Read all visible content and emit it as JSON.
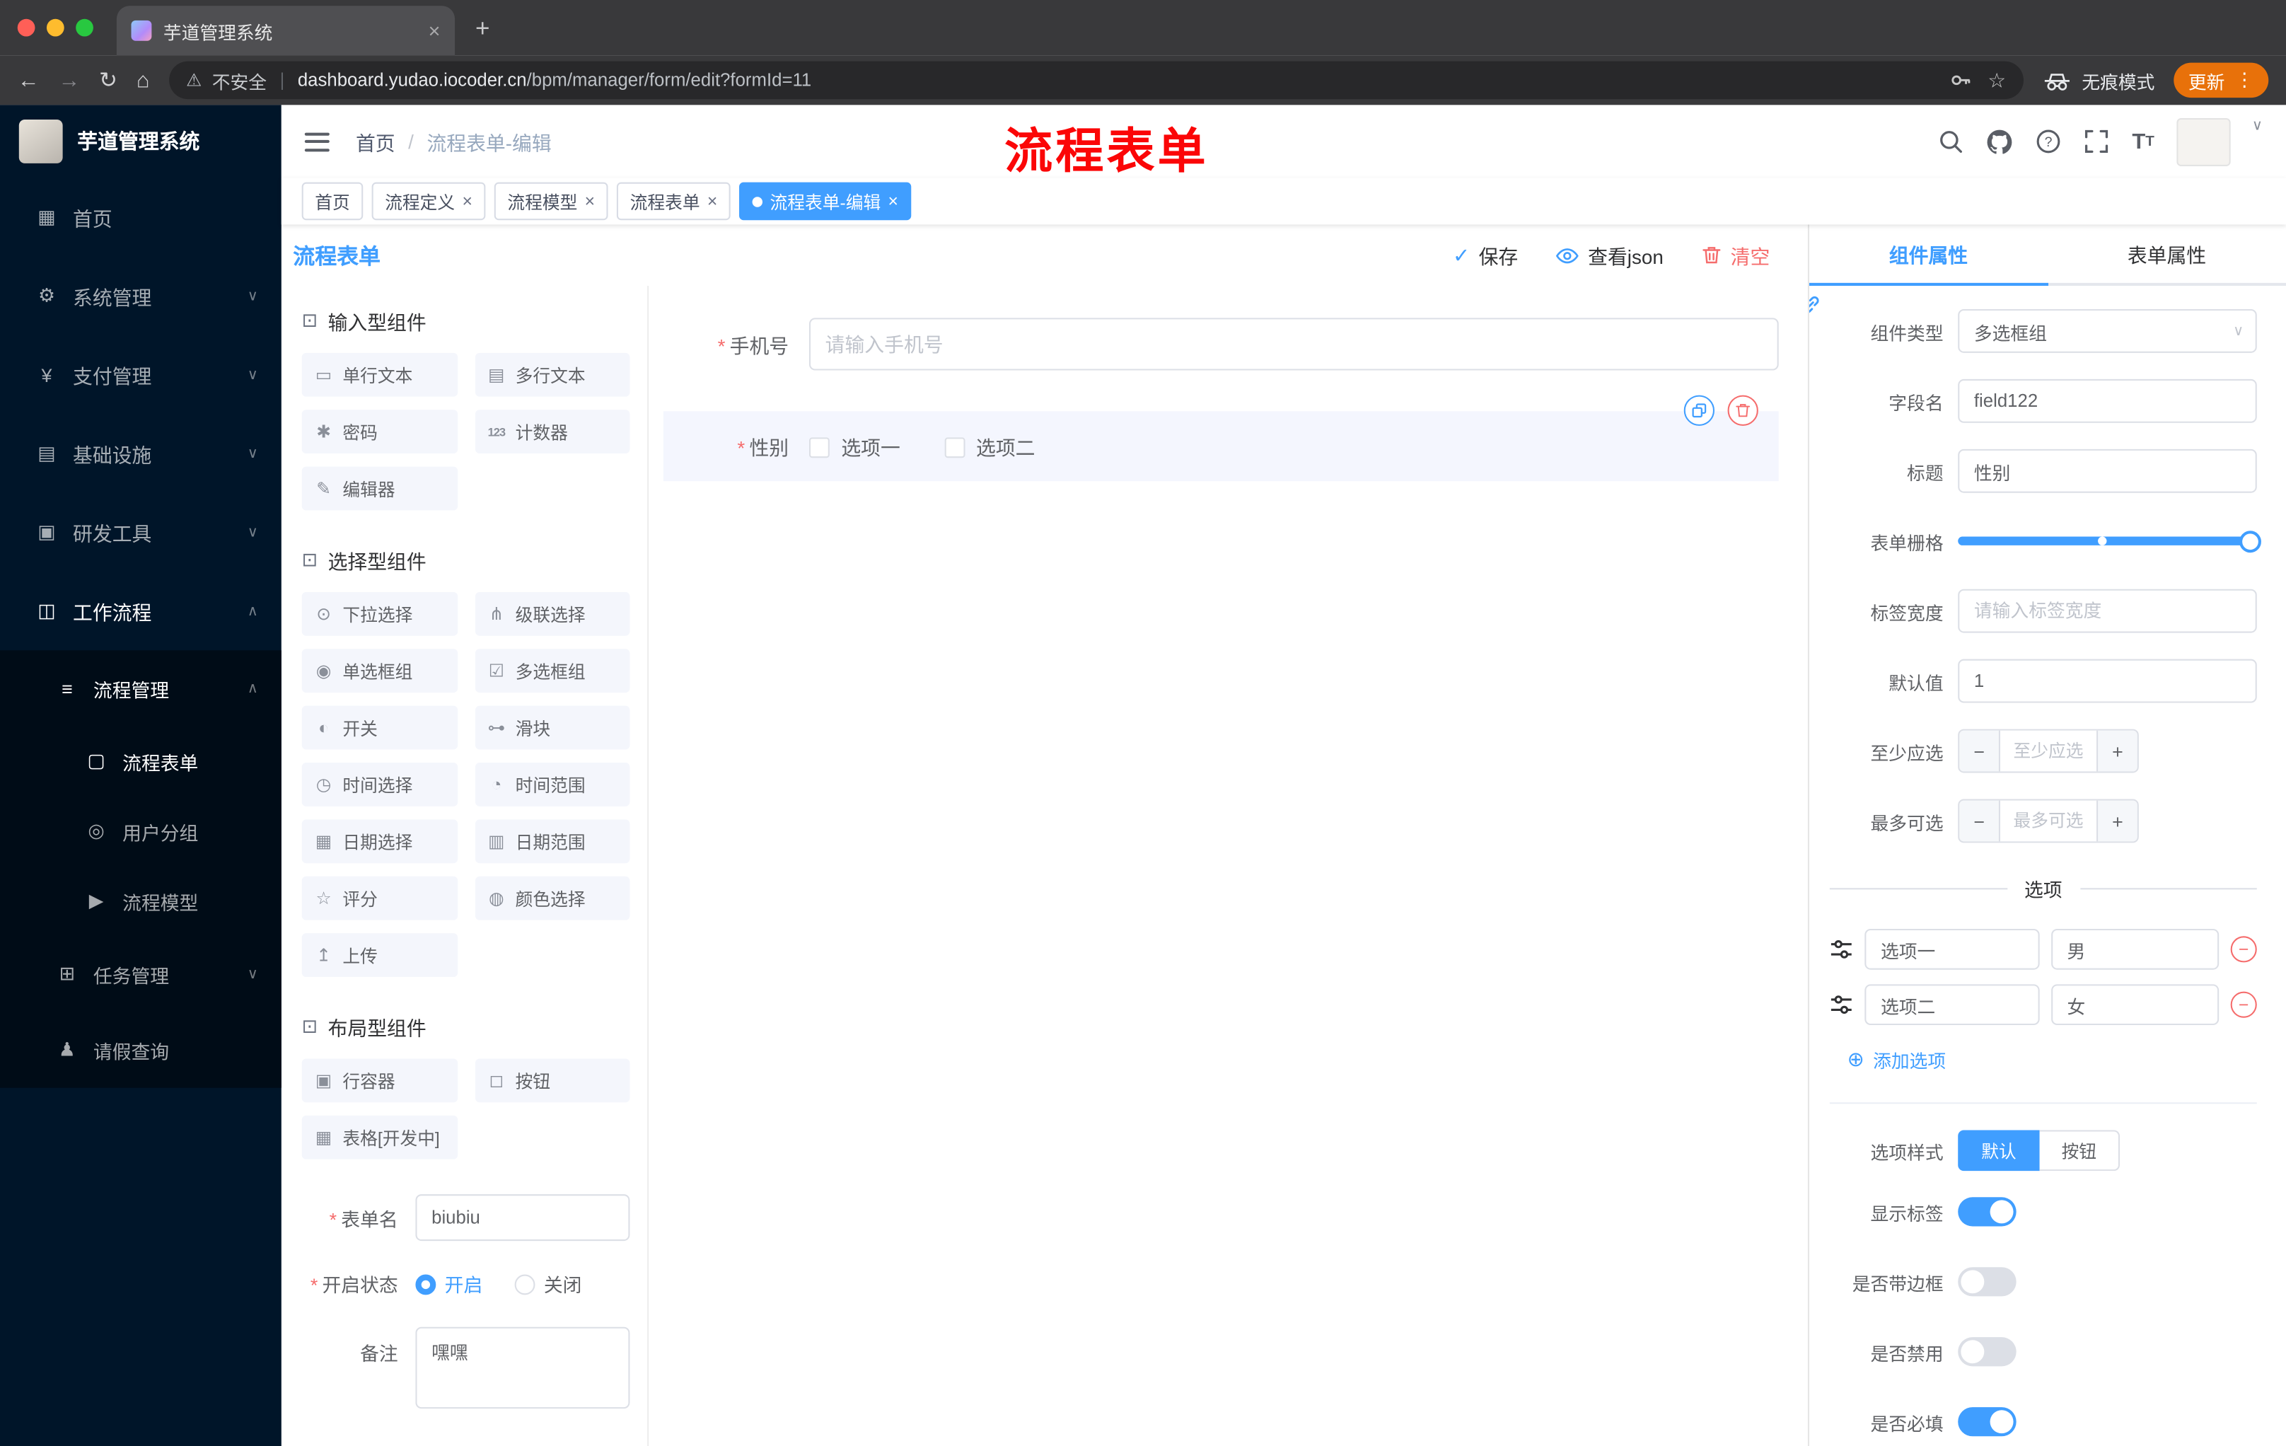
{
  "browser": {
    "tab_title": "芋道管理系统",
    "security_label": "不安全",
    "url_domain": "dashboard.yudao.iocoder.cn",
    "url_path": "/bpm/manager/form/edit?formId=11",
    "incognito_label": "无痕模式",
    "update_label": "更新"
  },
  "header": {
    "breadcrumb_home": "首页",
    "breadcrumb_current": "流程表单-编辑",
    "annotation": "流程表单"
  },
  "tags": [
    {
      "label": "首页"
    },
    {
      "label": "流程定义"
    },
    {
      "label": "流程模型"
    },
    {
      "label": "流程表单"
    },
    {
      "label": "流程表单-编辑"
    }
  ],
  "sidebar": {
    "logo_title": "芋道管理系统",
    "items": [
      {
        "label": "首页",
        "icon": "▦"
      },
      {
        "label": "系统管理",
        "icon": "⚙",
        "chevron": "∨"
      },
      {
        "label": "支付管理",
        "icon": "¥",
        "chevron": "∨"
      },
      {
        "label": "基础设施",
        "icon": "▤",
        "chevron": "∨"
      },
      {
        "label": "研发工具",
        "icon": "▣",
        "chevron": "∨"
      },
      {
        "label": "工作流程",
        "icon": "◫",
        "chevron": "∧"
      },
      {
        "label": "流程管理",
        "icon": "≡",
        "chevron": "∧"
      },
      {
        "label": "流程表单",
        "icon": "▢"
      },
      {
        "label": "用户分组",
        "icon": "◎"
      },
      {
        "label": "流程模型",
        "icon": "▶"
      },
      {
        "label": "任务管理",
        "icon": "⊞",
        "chevron": "∨"
      },
      {
        "label": "请假查询",
        "icon": "♟"
      }
    ]
  },
  "designer": {
    "title": "流程表单",
    "actions": {
      "save": "保存",
      "view_json": "查看json",
      "clear": "清空"
    },
    "palette": {
      "sections": [
        {
          "title": "输入型组件",
          "items": [
            {
              "icon": "▭",
              "label": "单行文本"
            },
            {
              "icon": "▤",
              "label": "多行文本"
            },
            {
              "icon": "✱",
              "label": "密码"
            },
            {
              "icon": "123",
              "label": "计数器"
            },
            {
              "icon": "✎",
              "label": "编辑器"
            }
          ]
        },
        {
          "title": "选择型组件",
          "items": [
            {
              "icon": "⊙",
              "label": "下拉选择"
            },
            {
              "icon": "⋔",
              "label": "级联选择"
            },
            {
              "icon": "◉",
              "label": "单选框组"
            },
            {
              "icon": "☑",
              "label": "多选框组"
            },
            {
              "icon": "◐",
              "label": "开关"
            },
            {
              "icon": "⊶",
              "label": "滑块"
            },
            {
              "icon": "◷",
              "label": "时间选择"
            },
            {
              "icon": "◔",
              "label": "时间范围"
            },
            {
              "icon": "▦",
              "label": "日期选择"
            },
            {
              "icon": "▥",
              "label": "日期范围"
            },
            {
              "icon": "☆",
              "label": "评分"
            },
            {
              "icon": "◍",
              "label": "颜色选择"
            },
            {
              "icon": "↥",
              "label": "上传"
            }
          ]
        },
        {
          "title": "布局型组件",
          "items": [
            {
              "icon": "▣",
              "label": "行容器"
            },
            {
              "icon": "◻",
              "label": "按钮"
            },
            {
              "icon": "▦",
              "label": "表格[开发中]"
            }
          ]
        }
      ]
    },
    "meta": {
      "form_name_label": "表单名",
      "form_name_value": "biubiu",
      "status_label": "开启状态",
      "status_on": "开启",
      "status_off": "关闭",
      "remark_label": "备注",
      "remark_value": "嘿嘿"
    },
    "canvas": {
      "phone_label": "手机号",
      "phone_placeholder": "请输入手机号",
      "gender_label": "性别",
      "option1": "选项一",
      "option2": "选项二"
    }
  },
  "props": {
    "tab_component": "组件属性",
    "tab_form": "表单属性",
    "component_type_label": "组件类型",
    "component_type_value": "多选框组",
    "field_name_label": "字段名",
    "field_name_value": "field122",
    "title_label": "标题",
    "title_value": "性别",
    "grid_label": "表单栅格",
    "label_width_label": "标签宽度",
    "label_width_placeholder": "请输入标签宽度",
    "default_label": "默认值",
    "default_value": "1",
    "min_label": "至少应选",
    "min_placeholder": "至少应选",
    "max_label": "最多可选",
    "max_placeholder": "最多可选",
    "options_title": "选项",
    "options": [
      {
        "label": "选项一",
        "value": "男"
      },
      {
        "label": "选项二",
        "value": "女"
      }
    ],
    "add_option": "添加选项",
    "style_label": "选项样式",
    "style_default": "默认",
    "style_button": "按钮",
    "toggle_show_label": "显示标签",
    "toggle_border": "是否带边框",
    "toggle_disabled": "是否禁用",
    "toggle_required": "是否必填"
  },
  "colors": {
    "primary": "#409EFF",
    "danger": "#F56C6C",
    "sidebar_bg": "#001529",
    "annotation_red": "#FB0607",
    "update_button": "#E8710A"
  }
}
